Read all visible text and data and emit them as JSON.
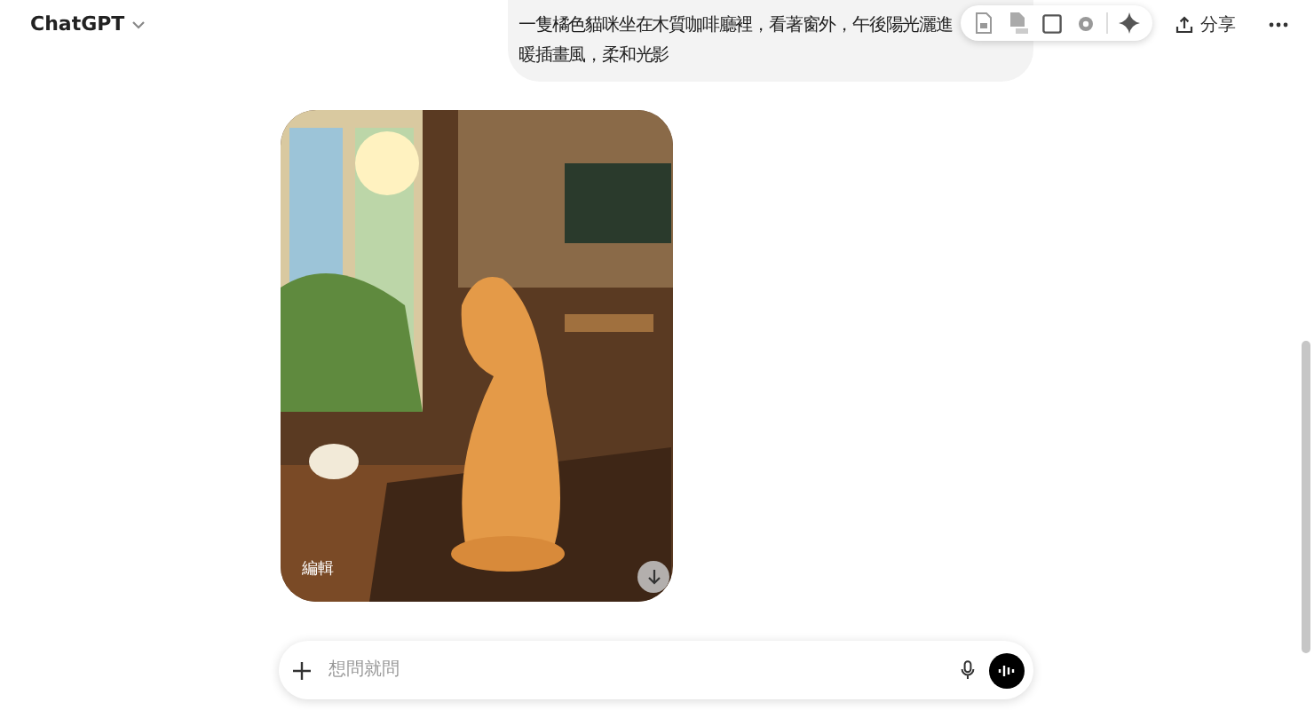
{
  "header": {
    "title": "ChatGPT",
    "share_label": "分享"
  },
  "user_message": {
    "lines": [
      "一隻橘色貓咪坐在木質咖啡廳裡，看著窗外，午後陽光灑進",
      "暖插畫風，柔和光影"
    ]
  },
  "image": {
    "kind": "picture",
    "edit_label": "編輯"
  },
  "composer": {
    "placeholder": "想問就問"
  }
}
